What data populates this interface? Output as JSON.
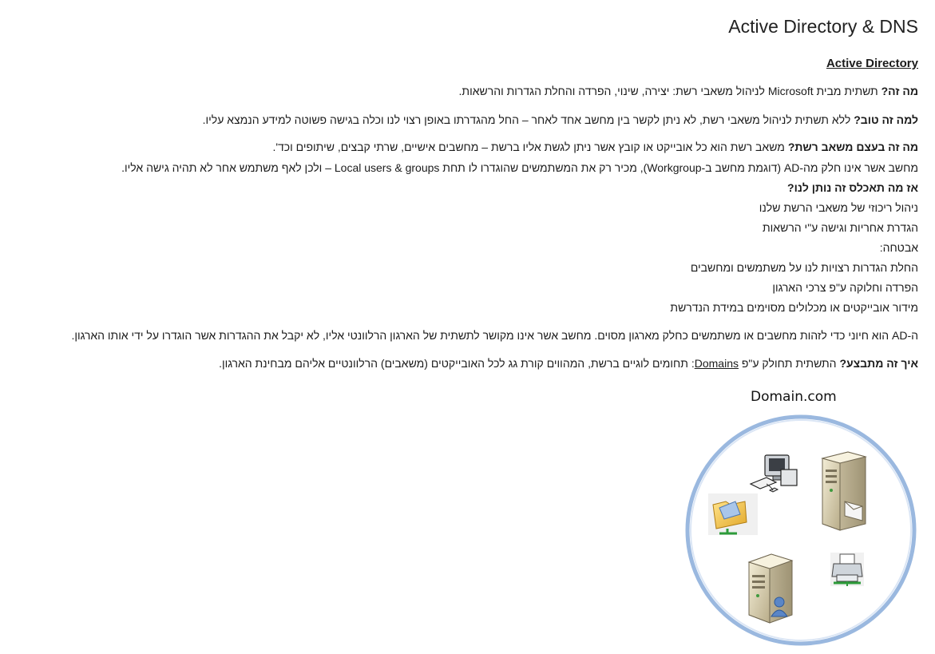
{
  "title": "Active Directory & DNS",
  "section_heading": "Active Directory",
  "paragraphs": {
    "what_is_label": "מה זה?",
    "what_is_text": " תשתית מבית Microsoft לניהול משאבי רשת: יצירה, שינוי, הפרדה והחלת הגדרות והרשאות.",
    "why_good_label": "למה זה טוב?",
    "why_good_text": " ללא תשתית לניהול משאבי רשת, לא ניתן לקשר בין מחשב אחד לאחר – החל מהגדרתו באופן רצוי לנו וכלה בגישה פשוטה למידע הנמצא עליו.",
    "resource_label": "מה זה בעצם משאב רשת?",
    "resource_text": " משאב רשת הוא כל אובייקט או קובץ אשר ניתן לגשת אליו ברשת – מחשבים אישיים, שרתי קבצים, שיתופים וכד'.",
    "workgroup_text": "מחשב אשר אינו חלק מה-AD (דוגמת מחשב ב-Workgroup), מכיר רק את המשתמשים שהוגדרו לו תחת Local users & groups – ולכן לאף משתמש אחר לא תהיה גישה אליו.",
    "benefits_label": "אז מה תאכלס זה נותן לנו?",
    "benefits": [
      "ניהול ריכוזי של משאבי הרשת שלנו",
      "הגדרת אחריות וגישה ע\"י הרשאות",
      "אבטחה:",
      "החלת הגדרות רצויות לנו על משתמשים ומחשבים",
      "הפרדה וחלוקה ע\"פ צרכי הארגון",
      "מידור אובייקטים או מכלולים מסוימים במידת הנדרשת"
    ],
    "ad_required_text": "ה-AD הוא חיוני כדי לזהות מחשבים או משתמשים כחלק מארגון מסוים. מחשב אשר אינו מקושר לתשתית של הארגון הרלוונטי אליו, לא יקבל את ההגדרות אשר הוגדרו על ידי אותו הארגון.",
    "how_label": "איך זה מתבצע?",
    "how_text_before": " התשתית תחולק ע\"פ ",
    "how_link": "Domains",
    "how_text_after": ": תחומים לוגיים ברשת, המהווים קורת גג לכל האובייקטים (משאבים) הרלוונטיים אליהם מבחינת הארגון."
  },
  "diagram": {
    "domain_label": "Domain.com",
    "icons": [
      "workstation-icon",
      "file-server-icon",
      "shared-folder-icon",
      "printer-icon",
      "user-server-icon"
    ],
    "circle_color": "#8fb3e0"
  }
}
